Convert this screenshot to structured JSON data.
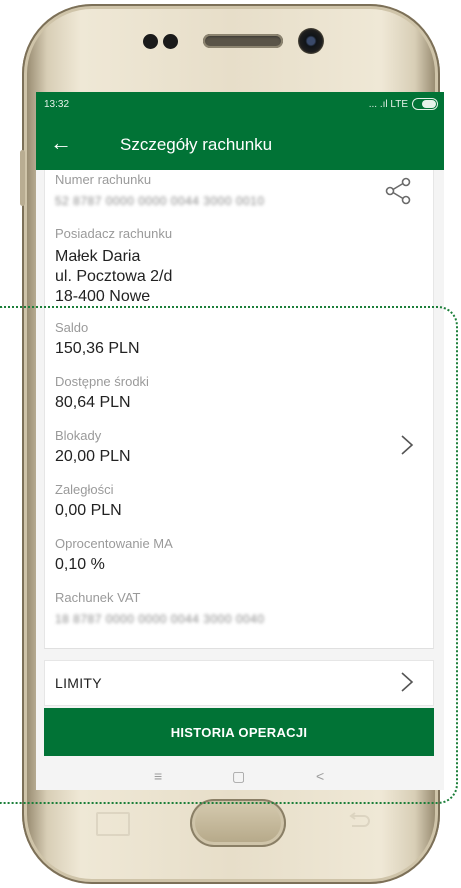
{
  "status_bar": {
    "time": "13:32",
    "network": "... .ıl LTE"
  },
  "header": {
    "title": "Szczegóły rachunku"
  },
  "account": {
    "number_label": "Numer rachunku",
    "number_value": "52 8787 0000 0000 0044 3000 0010",
    "owner_label": "Posiadacz rachunku",
    "owner_name": "Małek Daria",
    "owner_address1": "ul. Pocztowa 2/d",
    "owner_address2": "18-400 Nowe",
    "saldo_label": "Saldo",
    "saldo_value": "150,36 PLN",
    "available_label": "Dostępne środki",
    "available_value": "80,64 PLN",
    "blocks_label": "Blokady",
    "blocks_value": "20,00 PLN",
    "arrears_label": "Zaległości",
    "arrears_value": "0,00 PLN",
    "interest_label": "Oprocentowanie MA",
    "interest_value": "0,10 %",
    "vat_label": "Rachunek VAT",
    "vat_value": "18 8787 0000 0000 0044 3000 0040"
  },
  "limits": {
    "label": "LIMITY"
  },
  "actions": {
    "history_label": "HISTORIA OPERACJI"
  },
  "navbar": {
    "menu": "≡",
    "home": "▢",
    "back": "<"
  },
  "colors": {
    "brand_green": "#017336",
    "highlight_outline": "#1c7f3a"
  },
  "icons": [
    "back-arrow-icon",
    "share-icon",
    "chevron-right-icon",
    "battery-icon"
  ]
}
